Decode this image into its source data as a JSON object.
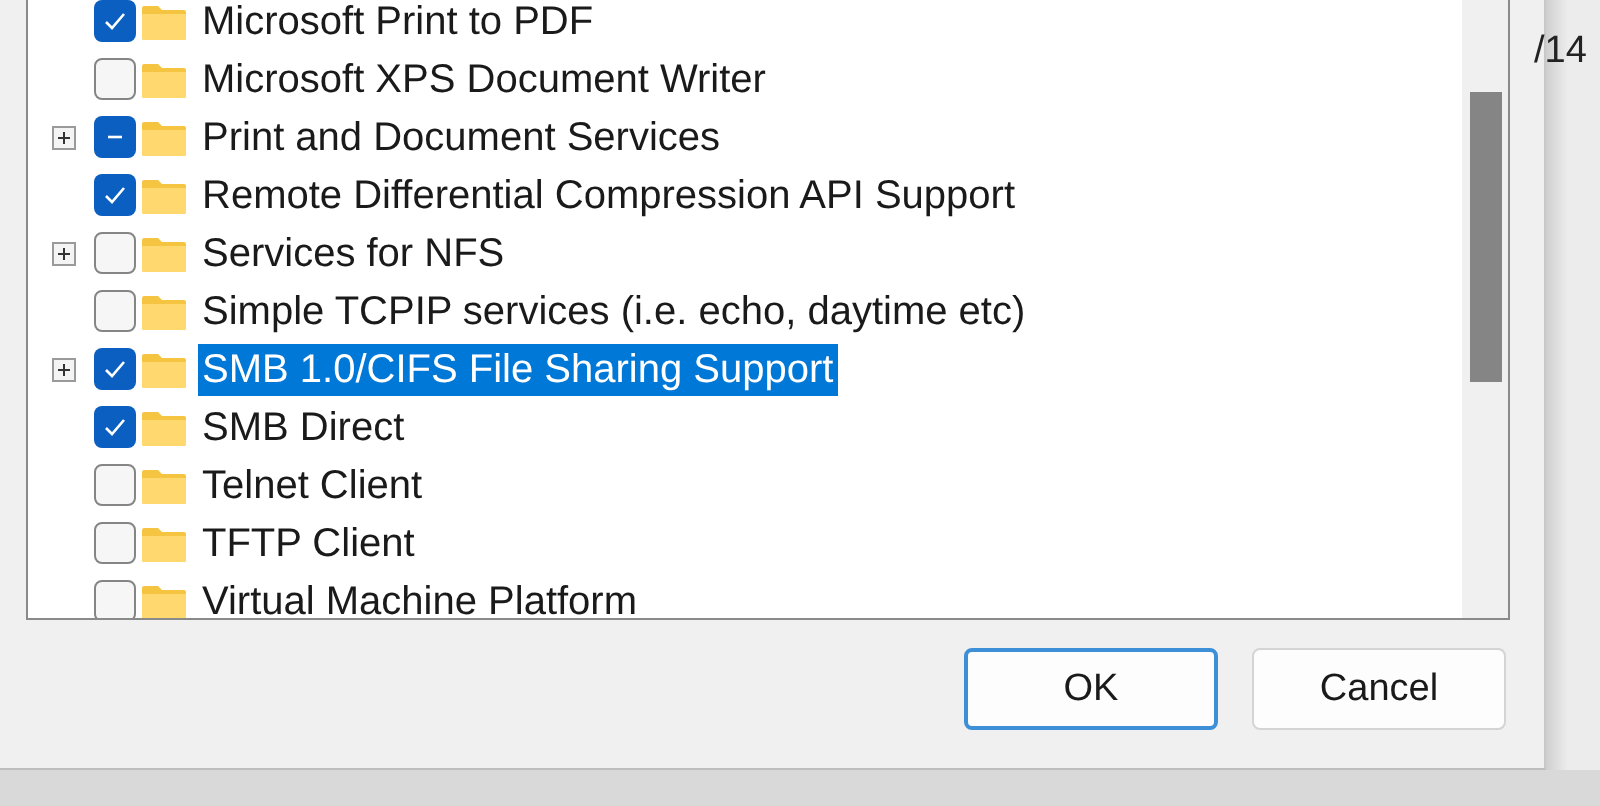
{
  "features": [
    {
      "label": "Microsoft Print to PDF",
      "checked": true,
      "indeterminate": false,
      "expandable": false,
      "selected": false
    },
    {
      "label": "Microsoft XPS Document Writer",
      "checked": false,
      "indeterminate": false,
      "expandable": false,
      "selected": false
    },
    {
      "label": "Print and Document Services",
      "checked": false,
      "indeterminate": true,
      "expandable": true,
      "selected": false
    },
    {
      "label": "Remote Differential Compression API Support",
      "checked": true,
      "indeterminate": false,
      "expandable": false,
      "selected": false
    },
    {
      "label": "Services for NFS",
      "checked": false,
      "indeterminate": false,
      "expandable": true,
      "selected": false
    },
    {
      "label": "Simple TCPIP services (i.e. echo, daytime etc)",
      "checked": false,
      "indeterminate": false,
      "expandable": false,
      "selected": false
    },
    {
      "label": "SMB 1.0/CIFS File Sharing Support",
      "checked": true,
      "indeterminate": false,
      "expandable": true,
      "selected": true
    },
    {
      "label": "SMB Direct",
      "checked": true,
      "indeterminate": false,
      "expandable": false,
      "selected": false
    },
    {
      "label": "Telnet Client",
      "checked": false,
      "indeterminate": false,
      "expandable": false,
      "selected": false
    },
    {
      "label": "TFTP Client",
      "checked": false,
      "indeterminate": false,
      "expandable": false,
      "selected": false
    },
    {
      "label": "Virtual Machine Platform",
      "checked": false,
      "indeterminate": false,
      "expandable": false,
      "selected": false
    }
  ],
  "buttons": [
    {
      "label": "OK",
      "default": true
    },
    {
      "label": "Cancel",
      "default": false
    }
  ],
  "background_text": "/14"
}
